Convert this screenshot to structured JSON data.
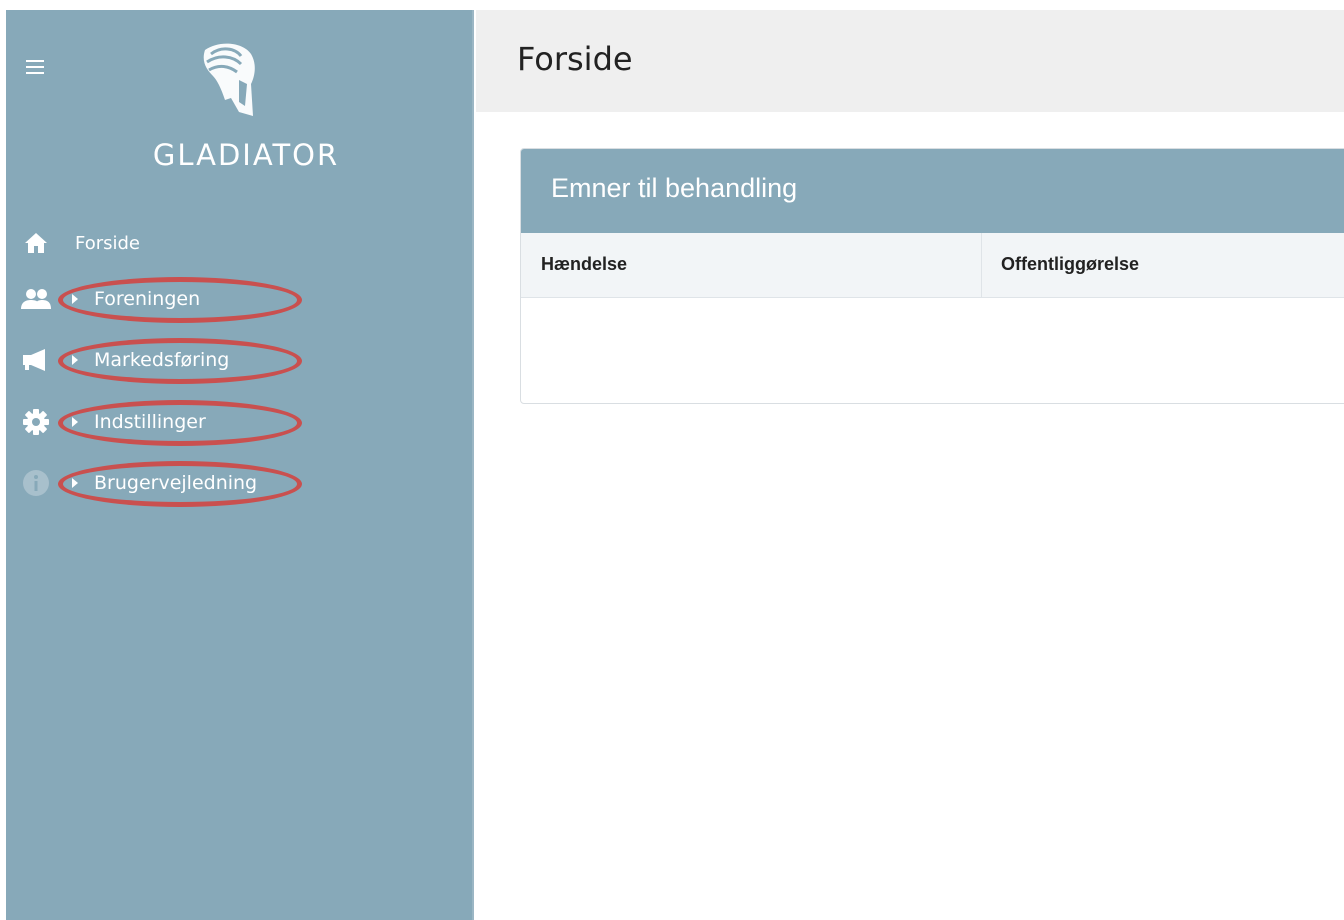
{
  "app": {
    "brand": "GLADIATOR"
  },
  "header": {
    "title": "Forside"
  },
  "sidebar": {
    "items": [
      {
        "label": "Forside",
        "icon": "home-icon",
        "expandable": false,
        "highlighted": false
      },
      {
        "label": "Foreningen",
        "icon": "people-icon",
        "expandable": true,
        "highlighted": true
      },
      {
        "label": "Markedsføring",
        "icon": "megaphone-icon",
        "expandable": true,
        "highlighted": true
      },
      {
        "label": "Indstillinger",
        "icon": "gear-icon",
        "expandable": true,
        "highlighted": true
      },
      {
        "label": "Brugervejledning",
        "icon": "info-icon",
        "expandable": true,
        "highlighted": true
      }
    ]
  },
  "panel": {
    "title": "Emner til behandling",
    "columns": [
      "Hændelse",
      "Offentliggørelse"
    ],
    "rows": []
  },
  "colors": {
    "sidebar": "#87a9b9",
    "header": "#efefef",
    "highlight_ring": "#c9504f",
    "text_on_sidebar": "#ffffff"
  }
}
